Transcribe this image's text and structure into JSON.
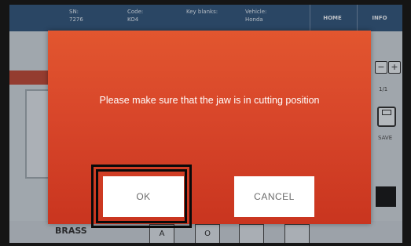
{
  "header": {
    "col1_title": "SN:",
    "col1_value": "7276",
    "col2_title": "Code:",
    "col2_value": "KO4",
    "col3_title": "Key blanks:",
    "col4_title": "Vehicle:",
    "col4_value": "Honda",
    "home_label": "HOME",
    "info_label": "INFO"
  },
  "right_panel": {
    "page_indicator": "1/1",
    "save_label": "SAVE"
  },
  "bottom_bar": {
    "material_label": "BRASS",
    "btn_a_label": "A",
    "btn_o_label": "O"
  },
  "dialog": {
    "message": "Please make sure that the jaw is in cutting position",
    "ok_label": "OK",
    "cancel_label": "CANCEL"
  },
  "colors": {
    "dialog_top": "#e2562f",
    "dialog_bottom": "#c9351f",
    "button_bg": "#ffffff",
    "topbar": "#2b4f75"
  }
}
